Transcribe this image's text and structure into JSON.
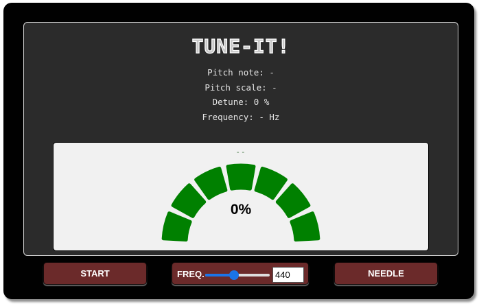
{
  "app": {
    "title": "TUNE-IT!"
  },
  "info": {
    "pitch_note": "Pitch note: -",
    "pitch_scale": "Pitch scale: -",
    "detune": "Detune: 0 %",
    "frequency": "Frequency: - Hz"
  },
  "meter": {
    "note_display": "--",
    "percent_text": "0%",
    "segment_count": 7,
    "segment_color": "#008000"
  },
  "controls": {
    "start_label": "START",
    "freq_label": "FREQ.",
    "freq_value": "440",
    "freq_slider_fraction": 0.45,
    "needle_label": "NEEDLE",
    "button_color": "#6b2a2a",
    "slider_color": "#1b74e8"
  },
  "icons": {
    "slider_thumb": "circle"
  }
}
